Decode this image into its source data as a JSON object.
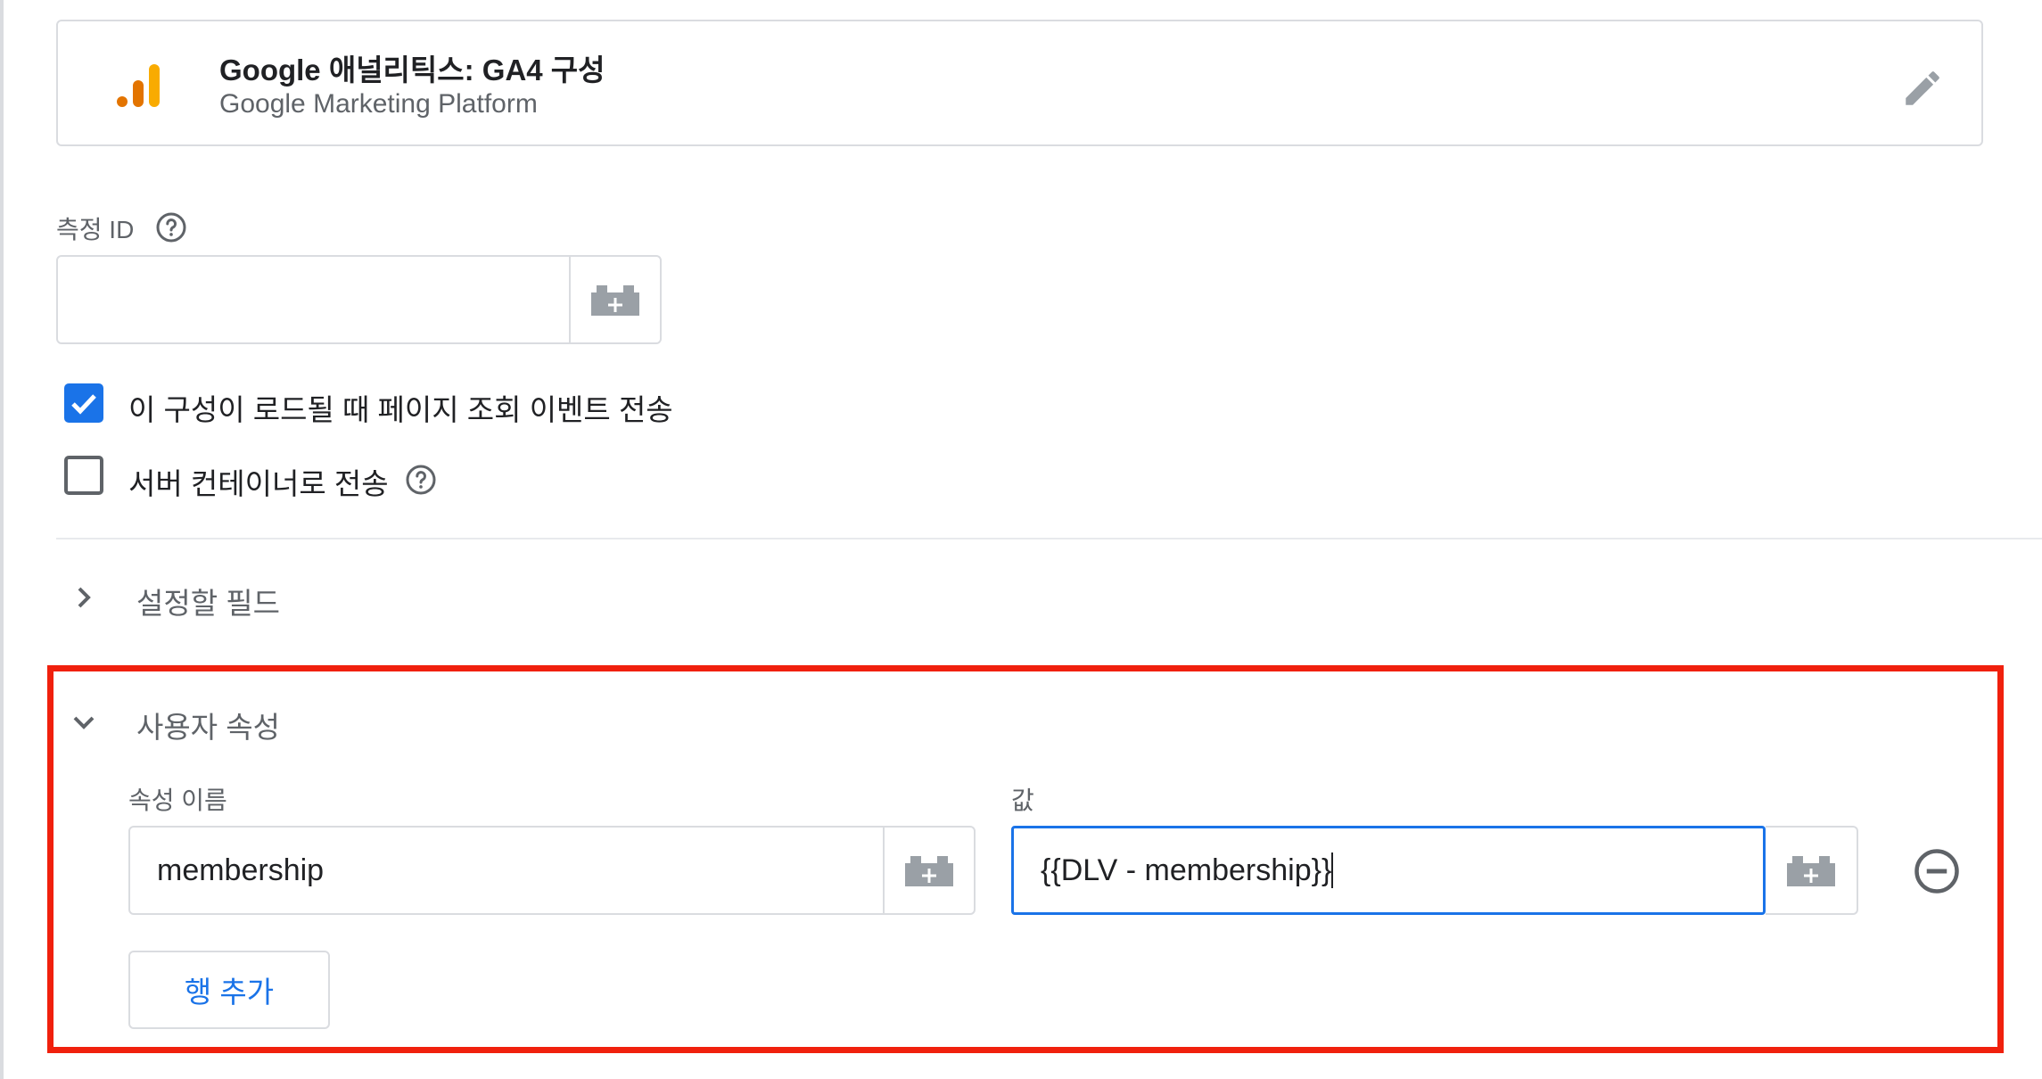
{
  "tag_type": {
    "title": "Google 애널리틱스: GA4 구성",
    "subtitle": "Google Marketing Platform",
    "logo_icon": "google-analytics-logo",
    "edit_icon": "pencil-icon"
  },
  "measurement_id": {
    "label": "측정 ID",
    "value": "",
    "help_icon": "help-circle-icon",
    "variable_icon": "variable-brick-icon"
  },
  "options": {
    "send_page_view": {
      "label": "이 구성이 로드될 때 페이지 조회 이벤트 전송",
      "checked": true
    },
    "send_to_server": {
      "label": "서버 컨테이너로 전송",
      "checked": false
    }
  },
  "sections": {
    "fields_to_set": {
      "title": "설정할 필드",
      "expanded": false
    },
    "user_properties": {
      "title": "사용자 속성",
      "expanded": true,
      "columns": {
        "name": "속성 이름",
        "value": "값"
      },
      "rows": [
        {
          "name": "membership",
          "value": "{{DLV - membership}}"
        }
      ],
      "add_row_label": "행 추가"
    }
  },
  "colors": {
    "accent": "#1a73e8",
    "highlight": "#f0200d",
    "logo_dark": "#e37400",
    "logo_light": "#f9ab00",
    "border": "#dadce0"
  }
}
